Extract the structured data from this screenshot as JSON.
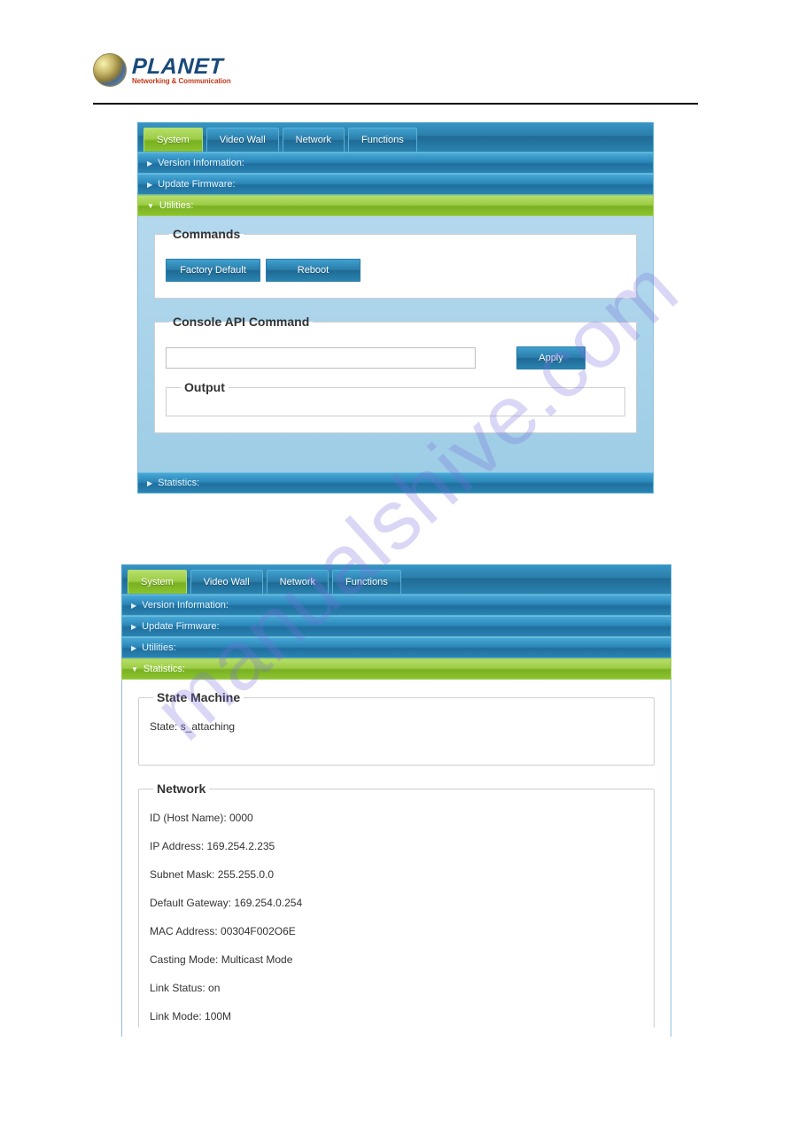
{
  "logo": {
    "brand": "PLANET",
    "tagline": "Networking & Communication"
  },
  "tabs": [
    "System",
    "Video Wall",
    "Network",
    "Functions"
  ],
  "accordion": {
    "version_info": "Version Information:",
    "update_fw": "Update Firmware:",
    "utilities": "Utilities:",
    "statistics": "Statistics:"
  },
  "utilities_panel": {
    "commands_title": "Commands",
    "factory_default": "Factory Default",
    "reboot": "Reboot",
    "console_title": "Console API Command",
    "apply": "Apply",
    "output_title": "Output"
  },
  "statistics_panel": {
    "state_machine_title": "State Machine",
    "state_line": "State: s_attaching",
    "network_title": "Network",
    "id_line": "ID (Host Name): 0000",
    "ip_line": "IP Address: 169.254.2.235",
    "subnet_line": "Subnet Mask: 255.255.0.0",
    "gateway_line": "Default Gateway: 169.254.0.254",
    "mac_line": "MAC Address:  00304F002O6E",
    "casting_line": "Casting Mode: Multicast Mode",
    "linkstatus_line": "Link Status: on",
    "linkmode_line": "Link Mode: 100M"
  },
  "watermark": "manualshive.com"
}
